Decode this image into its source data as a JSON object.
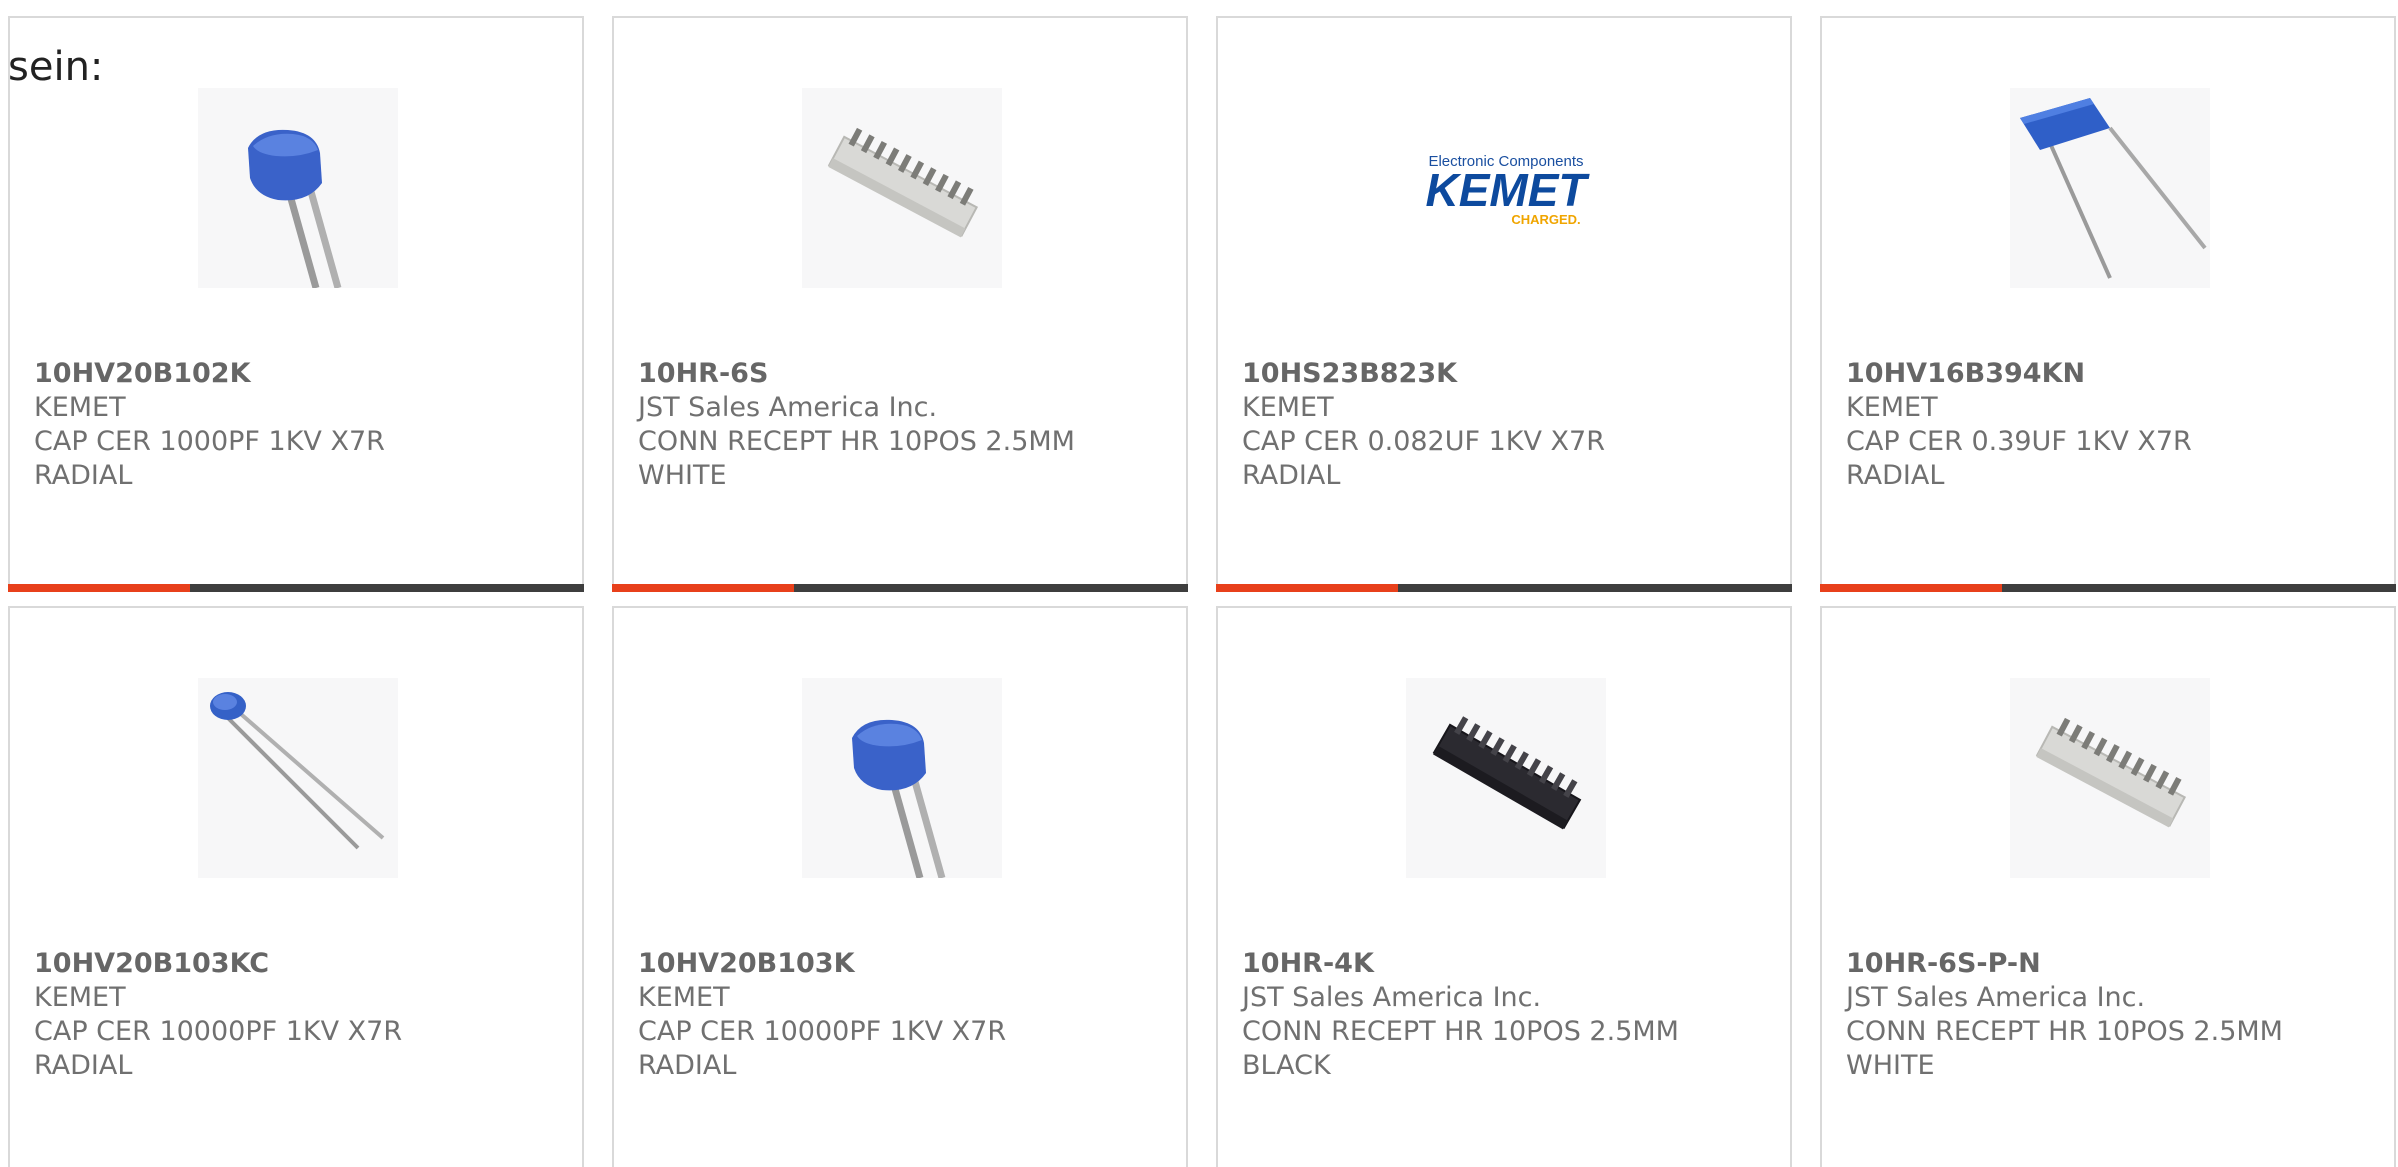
{
  "intro_text": "sein:",
  "colors": {
    "accent": "#e8401b",
    "bar_dark": "#3e3e3e",
    "text_gray": "#707070"
  },
  "products": [
    {
      "part": "10HV20B102K",
      "maker": "KEMET",
      "desc1": "CAP CER 1000PF 1KV X7R",
      "desc2": "RADIAL",
      "image": "blue-cube-capacitor-icon"
    },
    {
      "part": "10HR-6S",
      "maker": "JST Sales America Inc.",
      "desc1": "CONN RECEPT HR 10POS 2.5MM",
      "desc2": "WHITE",
      "image": "white-connector-icon"
    },
    {
      "part": "10HS23B823K",
      "maker": "KEMET",
      "desc1": "CAP CER 0.082UF 1KV X7R",
      "desc2": "RADIAL",
      "image": "kemet-logo",
      "logo": {
        "top": "Electronic Components",
        "main": "KEMET",
        "sub": "CHARGED."
      }
    },
    {
      "part": "10HV16B394KN",
      "maker": "KEMET",
      "desc1": "CAP CER 0.39UF 1KV X7R",
      "desc2": "RADIAL",
      "image": "blue-film-capacitor-icon"
    },
    {
      "part": "10HV20B103KC",
      "maker": "KEMET",
      "desc1": "CAP CER 10000PF 1KV X7R",
      "desc2": "RADIAL",
      "image": "small-blue-capacitor-icon"
    },
    {
      "part": "10HV20B103K",
      "maker": "KEMET",
      "desc1": "CAP CER 10000PF 1KV X7R",
      "desc2": "RADIAL",
      "image": "blue-cube-capacitor-icon"
    },
    {
      "part": "10HR-4K",
      "maker": "JST Sales America Inc.",
      "desc1": "CONN RECEPT HR 10POS 2.5MM",
      "desc2": "BLACK",
      "image": "black-connector-icon"
    },
    {
      "part": "10HR-6S-P-N",
      "maker": "JST Sales America Inc.",
      "desc1": "CONN RECEPT HR 10POS 2.5MM",
      "desc2": "WHITE",
      "image": "white-connector-icon"
    }
  ]
}
